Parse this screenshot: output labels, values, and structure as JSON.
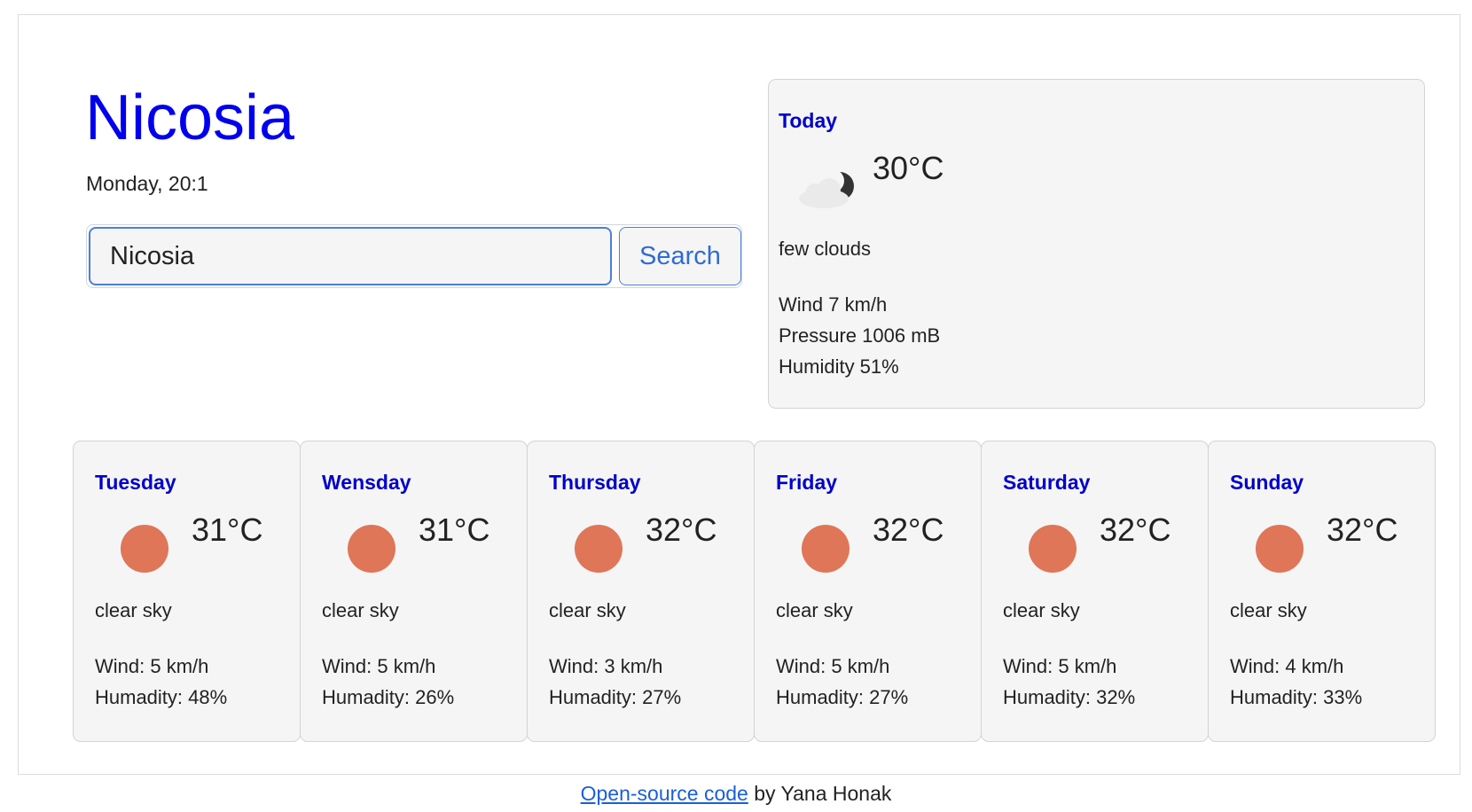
{
  "header": {
    "city": "Nicosia",
    "datetime": "Monday, 20:1"
  },
  "search": {
    "value": "Nicosia",
    "button_label": "Search"
  },
  "today": {
    "label": "Today",
    "icon": "few-clouds-night-icon",
    "temperature": "30°C",
    "description": "few clouds",
    "wind": "Wind 7 km/h",
    "pressure": "Pressure 1006 mB",
    "humidity": "Humidity 51%"
  },
  "forecast": [
    {
      "day": "Tuesday",
      "icon": "sun-icon",
      "temperature": "31°C",
      "description": "clear sky",
      "wind": "Wind: 5 km/h",
      "humidity": "Humadity: 48%"
    },
    {
      "day": "Wensday",
      "icon": "sun-icon",
      "temperature": "31°C",
      "description": "clear sky",
      "wind": "Wind: 5 km/h",
      "humidity": "Humadity: 26%"
    },
    {
      "day": "Thursday",
      "icon": "sun-icon",
      "temperature": "32°C",
      "description": "clear sky",
      "wind": "Wind: 3 km/h",
      "humidity": "Humadity: 27%"
    },
    {
      "day": "Friday",
      "icon": "sun-icon",
      "temperature": "32°C",
      "description": "clear sky",
      "wind": "Wind: 5 km/h",
      "humidity": "Humadity: 27%"
    },
    {
      "day": "Saturday",
      "icon": "sun-icon",
      "temperature": "32°C",
      "description": "clear sky",
      "wind": "Wind: 5 km/h",
      "humidity": "Humadity: 32%"
    },
    {
      "day": "Sunday",
      "icon": "sun-icon",
      "temperature": "32°C",
      "description": "clear sky",
      "wind": "Wind: 4 km/h",
      "humidity": "Humadity: 33%"
    }
  ],
  "footer": {
    "link_text": "Open-source code",
    "suffix": " by Yana Honak"
  },
  "colors": {
    "city_title": "#0000ee",
    "day_label": "#0000cc",
    "sun": "#df7658",
    "card_bg": "#f5f5f5",
    "accent": "#4d7fd6",
    "link": "#1a5fd6"
  }
}
